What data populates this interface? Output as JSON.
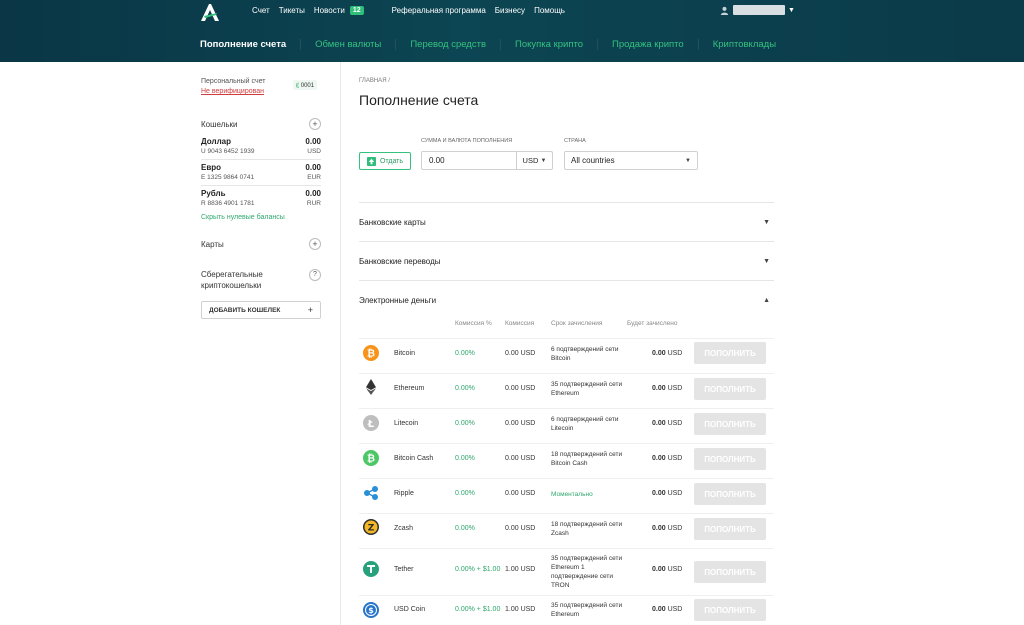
{
  "header": {
    "topnav": [
      "Счет",
      "Тикеты",
      "Новости"
    ],
    "news_count": "12",
    "topnav2": [
      "Реферальная программа",
      "Бизнесу",
      "Помощь"
    ],
    "subnav": [
      "Пополнение счета",
      "Обмен валюты",
      "Перевод средств",
      "Покупка крипто",
      "Продажа крипто",
      "Криптовклады"
    ]
  },
  "sidebar": {
    "account_label": "Персональный счет",
    "account_id": "0001",
    "unverified": "Не верифицирован",
    "wallets_title": "Кошельки",
    "wallets": [
      {
        "name": "Доллар",
        "number": "U 9043 6452 1939",
        "balance": "0.00",
        "currency": "USD"
      },
      {
        "name": "Евро",
        "number": "E 1325 9864 0741",
        "balance": "0.00",
        "currency": "EUR"
      },
      {
        "name": "Рубль",
        "number": "R 8836 4901 1781",
        "balance": "0.00",
        "currency": "RUR"
      }
    ],
    "hide_zero": "Скрыть нулевые балансы",
    "cards_title": "Карты",
    "savings_title": "Сберегательные криптокошельки",
    "add_wallet": "ДОБАВИТЬ КОШЕЛЕК"
  },
  "main": {
    "breadcrumb": "ГЛАВНАЯ /",
    "title": "Пополнение счета",
    "give_label": "Отдать",
    "amount_label": "СУММА И ВАЛЮТА ПОПОЛНЕНИЯ",
    "amount_value": "0.00",
    "currency": "USD",
    "country_label": "СТРАНА",
    "country_value": "All countries",
    "sections": [
      "Банковские карты",
      "Банковские переводы",
      "Электронные деньги"
    ],
    "columns": [
      "Комиссия %",
      "Комиссия",
      "Срок зачисления",
      "Будет зачислено"
    ],
    "button_label": "ПОПОЛНИТЬ",
    "rows": [
      {
        "name": "Bitcoin",
        "pct": "0.00%",
        "fee": "0.00 USD",
        "term": "6 подтверждений сети Bitcoin",
        "recv_amount": "0.00",
        "recv_cur": "USD"
      },
      {
        "name": "Ethereum",
        "pct": "0.00%",
        "fee": "0.00 USD",
        "term": "35 подтверждений сети Ethereum",
        "recv_amount": "0.00",
        "recv_cur": "USD"
      },
      {
        "name": "Litecoin",
        "pct": "0.00%",
        "fee": "0.00 USD",
        "term": "6 подтверждений сети Litecoin",
        "recv_amount": "0.00",
        "recv_cur": "USD"
      },
      {
        "name": "Bitcoin Cash",
        "pct": "0.00%",
        "fee": "0.00 USD",
        "term": "18 подтверждений сети Bitcoin Cash",
        "recv_amount": "0.00",
        "recv_cur": "USD"
      },
      {
        "name": "Ripple",
        "pct": "0.00%",
        "fee": "0.00 USD",
        "term": "Моментально",
        "recv_amount": "0.00",
        "recv_cur": "USD"
      },
      {
        "name": "Zcash",
        "pct": "0.00%",
        "fee": "0.00 USD",
        "term": "18 подтверждений сети Zcash",
        "recv_amount": "0.00",
        "recv_cur": "USD"
      },
      {
        "name": "Tether",
        "pct": "0.00% + $1.00",
        "fee": "1.00 USD",
        "term": "35 подтверждений сети Ethereum 1 подтверждение сети TRON",
        "recv_amount": "0.00",
        "recv_cur": "USD"
      },
      {
        "name": "USD Coin",
        "pct": "0.00% + $1.00",
        "fee": "1.00 USD",
        "term": "35 подтверждений сети Ethereum",
        "recv_amount": "0.00",
        "recv_cur": "USD"
      }
    ]
  },
  "colors": {
    "header_bg": "#0b3a48",
    "accent_green": "#35c27f",
    "alert_red": "#d23c3c",
    "btn_disabled": "#e4e4e4"
  },
  "icons": [
    "bitcoin-icon",
    "ethereum-icon",
    "litecoin-icon",
    "bitcoin-cash-icon",
    "ripple-icon",
    "zcash-icon",
    "tether-icon",
    "usd-coin-icon"
  ]
}
